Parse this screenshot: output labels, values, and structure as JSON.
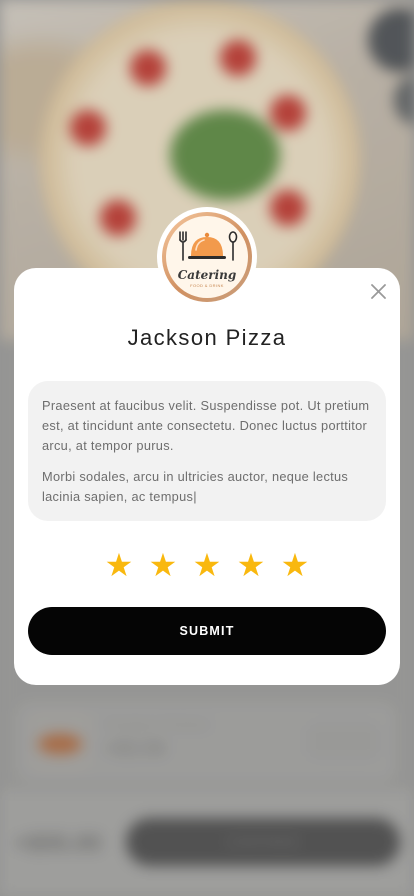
{
  "background": {
    "item_name": "Smoked Chicken",
    "item_price": "+$3.50",
    "total": "+$55.00",
    "continue_label": "CONTINUE"
  },
  "modal": {
    "logo_title": "Catering",
    "logo_subtitle": "FOOD & DRINK",
    "restaurant_name": "Jackson Pizza",
    "review_paragraphs": [
      "Praesent at faucibus velit. Suspendisse pot. Ut pretium est, at tincidunt ante consectetu. Donec luctus porttitor arcu, at tempor purus.",
      "Morbi sodales, arcu in ultricies auctor, neque lectus lacinia sapien, ac tempus|"
    ],
    "rating": 5,
    "rating_max": 5,
    "star_glyph": "★",
    "submit_label": "SUBMIT",
    "icons": [
      "close-icon",
      "catering-logo",
      "star-icon"
    ],
    "colors": {
      "star": "#f9b80e",
      "button": "#050505",
      "review_bg": "#f2f2f2"
    }
  }
}
